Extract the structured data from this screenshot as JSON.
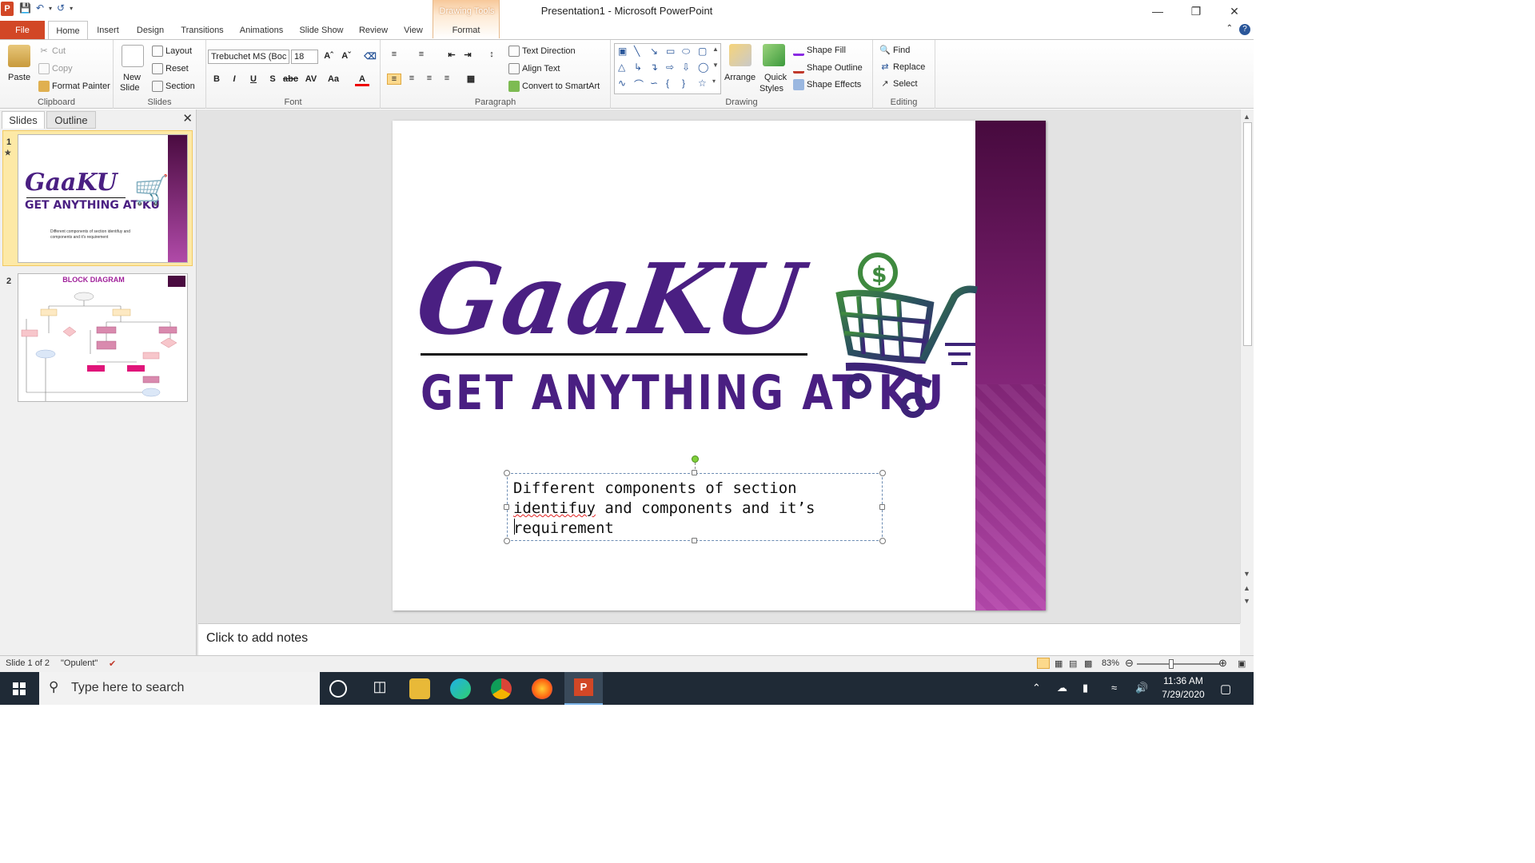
{
  "titlebar": {
    "title": "Presentation1  -  Microsoft PowerPoint",
    "contextual_tab_group": "Drawing Tools"
  },
  "tabs": {
    "file": "File",
    "home": "Home",
    "insert": "Insert",
    "design": "Design",
    "transitions": "Transitions",
    "animations": "Animations",
    "slideshow": "Slide Show",
    "review": "Review",
    "view": "View",
    "format": "Format"
  },
  "ribbon": {
    "clipboard": {
      "label": "Clipboard",
      "paste": "Paste",
      "cut": "Cut",
      "copy": "Copy",
      "format_painter": "Format Painter"
    },
    "slides": {
      "label": "Slides",
      "new_slide_1": "New",
      "new_slide_2": "Slide",
      "layout": "Layout",
      "reset": "Reset",
      "section": "Section"
    },
    "font": {
      "label": "Font",
      "family": "Trebuchet MS (Boc",
      "size": "18"
    },
    "paragraph": {
      "label": "Paragraph",
      "text_direction": "Text Direction",
      "align_text": "Align Text",
      "convert_smartart": "Convert to SmartArt"
    },
    "drawing": {
      "label": "Drawing",
      "arrange": "Arrange",
      "quick_styles_1": "Quick",
      "quick_styles_2": "Styles",
      "shape_fill": "Shape Fill",
      "shape_outline": "Shape Outline",
      "shape_effects": "Shape Effects"
    },
    "editing": {
      "label": "Editing",
      "find": "Find",
      "replace": "Replace",
      "select": "Select"
    }
  },
  "slides_pane": {
    "tab_slides": "Slides",
    "tab_outline": "Outline",
    "thumb1": {
      "num": "1",
      "logo": "GaaKU",
      "sub": "GET ANYTHING AT KU",
      "body": "Different components of section identifuy and components and it's requirement"
    },
    "thumb2": {
      "num": "2",
      "title": "BLOCK DIAGRAM"
    }
  },
  "slide": {
    "logo_text": "GaaKU",
    "logo_sub": "GET ANYTHING AT KU",
    "body_part1": "Different components of section ",
    "body_misspelled": "identifuy",
    "body_part2": " and components and it’s requirement"
  },
  "notes": {
    "placeholder": "Click to add notes"
  },
  "status": {
    "slide_of": "Slide 1 of 2",
    "theme": "\"Opulent\"",
    "zoom": "83%"
  },
  "taskbar": {
    "search_placeholder": "Type here to search",
    "time": "11:36 AM",
    "date": "7/29/2020"
  },
  "colors": {
    "brand_purple": "#4a1f82",
    "file_tab": "#d24726",
    "accent_bar_top": "#470a3e",
    "accent_bar_bottom": "#b548ac"
  }
}
